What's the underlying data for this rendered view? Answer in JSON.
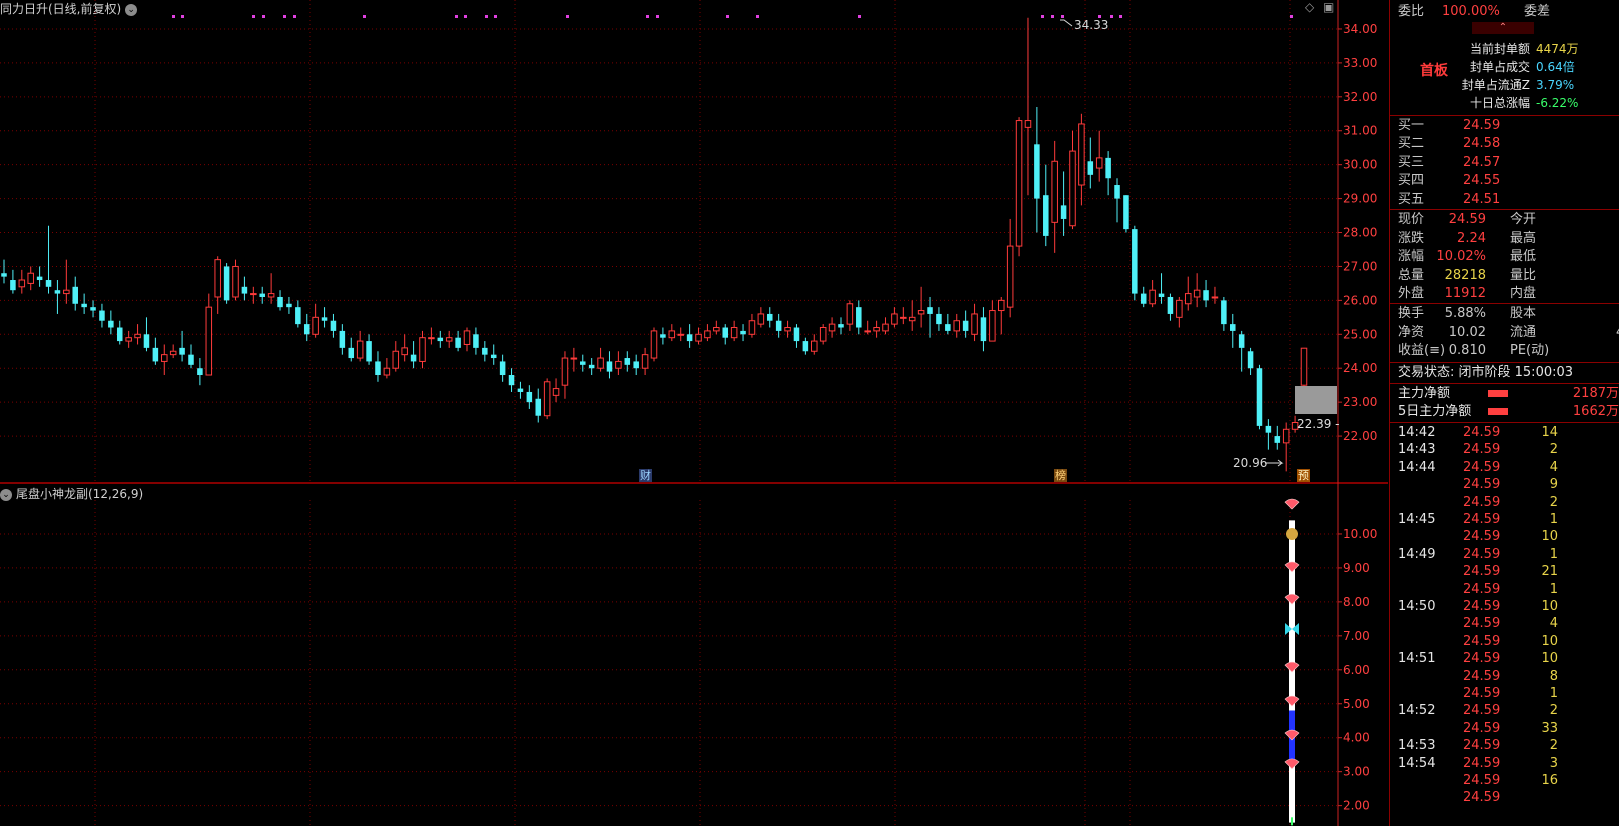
{
  "main_chart": {
    "title": "同力日升(日线,前复权)",
    "high_label": "34.33",
    "low_label": "20.96",
    "price_now_label": "22.39",
    "markers": [
      {
        "text": "财"
      },
      {
        "text": "榜"
      },
      {
        "text": "预"
      }
    ]
  },
  "sub_chart": {
    "title": "尾盘小神龙副(12,26,9)"
  },
  "chart_data": [
    {
      "type": "candlestick",
      "ylim": [
        21,
        34.5
      ],
      "y_ticks": [
        "22.00",
        "23.00",
        "24.00",
        "25.00",
        "26.00",
        "27.00",
        "28.00",
        "29.00",
        "30.00",
        "31.00",
        "32.00",
        "33.00",
        "34.00"
      ],
      "candles": [
        [
          26.8,
          26.7,
          27.2,
          26.5
        ],
        [
          26.6,
          26.3,
          26.9,
          26.2
        ],
        [
          26.4,
          26.6,
          26.9,
          26.2
        ],
        [
          26.5,
          26.8,
          27.0,
          26.3
        ],
        [
          26.7,
          26.6,
          27.0,
          26.4
        ],
        [
          26.6,
          26.4,
          28.2,
          26.2
        ],
        [
          26.3,
          26.2,
          26.6,
          25.6
        ],
        [
          26.2,
          26.3,
          27.2,
          25.9
        ],
        [
          26.4,
          25.9,
          26.7,
          25.7
        ],
        [
          25.9,
          25.8,
          26.2,
          25.6
        ],
        [
          25.8,
          25.7,
          26.0,
          25.5
        ],
        [
          25.7,
          25.4,
          25.9,
          25.2
        ],
        [
          25.4,
          25.2,
          25.7,
          25.0
        ],
        [
          25.2,
          24.8,
          25.4,
          24.7
        ],
        [
          24.8,
          24.9,
          25.1,
          24.6
        ],
        [
          24.9,
          25.0,
          25.3,
          24.7
        ],
        [
          25.0,
          24.6,
          25.5,
          24.5
        ],
        [
          24.6,
          24.2,
          24.9,
          24.1
        ],
        [
          24.2,
          24.4,
          24.7,
          23.8
        ],
        [
          24.4,
          24.5,
          24.7,
          24.3
        ],
        [
          24.6,
          24.4,
          25.1,
          24.2
        ],
        [
          24.4,
          24.1,
          24.7,
          24.0
        ],
        [
          24.0,
          23.8,
          24.3,
          23.5
        ],
        [
          23.8,
          25.8,
          26.2,
          23.8
        ],
        [
          26.1,
          27.2,
          27.3,
          25.6
        ],
        [
          27.0,
          26.0,
          27.1,
          25.9
        ],
        [
          26.1,
          27.0,
          27.2,
          26.0
        ],
        [
          26.4,
          26.2,
          26.7,
          26.0
        ],
        [
          26.2,
          26.2,
          26.4,
          25.9
        ],
        [
          26.2,
          26.1,
          26.4,
          25.9
        ],
        [
          26.1,
          26.2,
          26.8,
          25.9
        ],
        [
          26.1,
          25.8,
          26.3,
          25.7
        ],
        [
          25.9,
          25.8,
          26.1,
          25.6
        ],
        [
          25.8,
          25.3,
          26.0,
          25.2
        ],
        [
          25.3,
          25.0,
          25.6,
          24.8
        ],
        [
          25.0,
          25.5,
          25.9,
          24.9
        ],
        [
          25.5,
          25.4,
          25.8,
          25.2
        ],
        [
          25.4,
          25.1,
          25.6,
          24.9
        ],
        [
          25.1,
          24.6,
          25.3,
          24.4
        ],
        [
          24.6,
          24.3,
          24.9,
          24.2
        ],
        [
          24.3,
          24.8,
          25.1,
          24.2
        ],
        [
          24.8,
          24.2,
          25.0,
          24.1
        ],
        [
          24.2,
          23.8,
          24.5,
          23.6
        ],
        [
          23.8,
          24.0,
          24.3,
          23.7
        ],
        [
          24.0,
          24.5,
          24.8,
          23.9
        ],
        [
          24.4,
          24.6,
          25.0,
          24.2
        ],
        [
          24.4,
          24.2,
          24.8,
          24.0
        ],
        [
          24.2,
          24.9,
          25.1,
          24.0
        ],
        [
          24.9,
          24.9,
          25.2,
          24.7
        ],
        [
          24.9,
          24.8,
          25.1,
          24.6
        ],
        [
          24.8,
          24.9,
          25.1,
          24.6
        ],
        [
          24.9,
          24.6,
          25.1,
          24.5
        ],
        [
          24.7,
          25.1,
          25.2,
          24.5
        ],
        [
          25.0,
          24.6,
          25.2,
          24.4
        ],
        [
          24.6,
          24.4,
          24.8,
          24.2
        ],
        [
          24.4,
          24.3,
          24.7,
          24.1
        ],
        [
          24.2,
          23.8,
          24.4,
          23.6
        ],
        [
          23.8,
          23.5,
          24.0,
          23.3
        ],
        [
          23.4,
          23.3,
          23.6,
          23.1
        ],
        [
          23.3,
          23.0,
          23.5,
          22.8
        ],
        [
          23.1,
          22.6,
          23.4,
          22.4
        ],
        [
          22.6,
          23.6,
          23.7,
          22.5
        ],
        [
          23.2,
          23.4,
          23.7,
          23.0
        ],
        [
          23.5,
          24.3,
          24.5,
          23.1
        ],
        [
          24.3,
          24.3,
          24.6,
          23.9
        ],
        [
          24.2,
          24.1,
          24.4,
          23.9
        ],
        [
          24.1,
          24.0,
          24.3,
          23.8
        ],
        [
          24.0,
          24.3,
          24.6,
          23.9
        ],
        [
          24.2,
          23.9,
          24.5,
          23.7
        ],
        [
          24.0,
          24.2,
          24.5,
          23.8
        ],
        [
          24.3,
          24.1,
          24.5,
          23.9
        ],
        [
          24.2,
          24.0,
          24.4,
          23.8
        ],
        [
          24.0,
          24.4,
          24.6,
          23.8
        ],
        [
          24.3,
          25.1,
          25.2,
          24.2
        ],
        [
          25.0,
          24.9,
          25.2,
          24.7
        ],
        [
          24.9,
          25.1,
          25.3,
          24.8
        ],
        [
          25.0,
          25.0,
          25.2,
          24.8
        ],
        [
          25.0,
          24.8,
          25.3,
          24.6
        ],
        [
          24.8,
          25.0,
          25.2,
          24.7
        ],
        [
          24.9,
          25.1,
          25.3,
          24.8
        ],
        [
          25.1,
          25.2,
          25.4,
          25.0
        ],
        [
          25.2,
          24.9,
          25.3,
          24.7
        ],
        [
          24.9,
          25.2,
          25.4,
          24.8
        ],
        [
          25.1,
          25.0,
          25.3,
          24.8
        ],
        [
          25.0,
          25.4,
          25.6,
          24.9
        ],
        [
          25.3,
          25.6,
          25.8,
          25.2
        ],
        [
          25.6,
          25.4,
          25.8,
          25.2
        ],
        [
          25.4,
          25.1,
          25.6,
          24.9
        ],
        [
          25.1,
          25.2,
          25.4,
          24.9
        ],
        [
          25.2,
          24.8,
          25.3,
          24.6
        ],
        [
          24.8,
          24.5,
          24.9,
          24.4
        ],
        [
          24.5,
          24.8,
          25.0,
          24.4
        ],
        [
          24.8,
          25.2,
          25.3,
          24.7
        ],
        [
          25.1,
          25.3,
          25.5,
          24.9
        ],
        [
          25.3,
          25.2,
          25.5,
          25.0
        ],
        [
          25.3,
          25.9,
          26.0,
          25.1
        ],
        [
          25.8,
          25.2,
          26.0,
          25.0
        ],
        [
          25.1,
          25.1,
          25.4,
          25.0
        ],
        [
          25.1,
          25.2,
          25.4,
          24.9
        ],
        [
          25.1,
          25.3,
          25.5,
          25.0
        ],
        [
          25.3,
          25.6,
          25.8,
          25.2
        ],
        [
          25.5,
          25.5,
          25.8,
          25.3
        ],
        [
          25.4,
          25.5,
          26.0,
          25.1
        ],
        [
          25.6,
          25.7,
          26.4,
          25.2
        ],
        [
          25.8,
          25.6,
          26.1,
          24.9
        ],
        [
          25.6,
          25.3,
          25.8,
          25.1
        ],
        [
          25.3,
          25.1,
          25.6,
          25.0
        ],
        [
          25.1,
          25.4,
          25.6,
          24.9
        ],
        [
          25.4,
          25.1,
          25.7,
          24.9
        ],
        [
          25.0,
          25.6,
          25.9,
          24.8
        ],
        [
          25.5,
          24.8,
          25.8,
          24.5
        ],
        [
          24.8,
          25.7,
          26.0,
          24.8
        ],
        [
          25.7,
          26.0,
          26.1,
          25.0
        ],
        [
          25.8,
          27.6,
          28.4,
          25.5
        ],
        [
          27.6,
          31.3,
          31.4,
          27.3
        ],
        [
          31.1,
          31.3,
          34.33,
          29.1
        ],
        [
          30.6,
          29.0,
          31.7,
          28.0
        ],
        [
          29.1,
          27.9,
          30.0,
          27.6
        ],
        [
          28.3,
          30.1,
          30.7,
          27.4
        ],
        [
          28.8,
          28.4,
          29.8,
          27.9
        ],
        [
          28.2,
          30.4,
          31.0,
          28.1
        ],
        [
          29.4,
          31.2,
          31.5,
          28.8
        ],
        [
          30.1,
          29.7,
          30.8,
          29.3
        ],
        [
          29.9,
          30.2,
          31.0,
          29.5
        ],
        [
          30.2,
          29.6,
          30.4,
          29.1
        ],
        [
          29.4,
          29.0,
          29.6,
          28.3
        ],
        [
          29.1,
          28.1,
          29.1,
          28.0
        ],
        [
          28.1,
          26.2,
          28.2,
          26.0
        ],
        [
          26.2,
          25.9,
          26.4,
          25.8
        ],
        [
          25.9,
          26.3,
          26.6,
          25.8
        ],
        [
          26.2,
          26.1,
          26.8,
          25.9
        ],
        [
          26.1,
          25.6,
          26.2,
          25.4
        ],
        [
          25.5,
          26.0,
          26.1,
          25.2
        ],
        [
          25.9,
          26.2,
          26.7,
          25.7
        ],
        [
          26.1,
          26.3,
          26.8,
          25.8
        ],
        [
          26.3,
          26.0,
          26.6,
          25.8
        ],
        [
          26.1,
          26.1,
          26.4,
          25.9
        ],
        [
          26.0,
          25.3,
          26.1,
          25.1
        ],
        [
          25.3,
          25.1,
          25.6,
          24.6
        ],
        [
          25.0,
          24.6,
          25.1,
          23.9
        ],
        [
          24.5,
          24.0,
          24.6,
          23.8
        ],
        [
          24.0,
          22.3,
          24.1,
          22.2
        ],
        [
          22.3,
          22.1,
          22.5,
          21.6
        ],
        [
          22.0,
          21.8,
          22.3,
          21.6
        ],
        [
          21.8,
          22.2,
          22.4,
          20.96
        ],
        [
          22.2,
          22.4,
          22.6,
          22.1
        ],
        [
          23.5,
          24.59,
          24.6,
          23.4
        ]
      ]
    },
    {
      "type": "indicator",
      "ylim": [
        1.4,
        11.0
      ],
      "y_ticks": [
        "2.00",
        "3.00",
        "4.00",
        "5.00",
        "6.00",
        "7.00",
        "8.00",
        "9.00",
        "10.00"
      ]
    }
  ],
  "panel": {
    "weibi_label": "委比",
    "weibi_value": "100.00%",
    "weicha_label": "委差",
    "board_label": "首板",
    "seal": [
      {
        "label": "当前封单额",
        "value": "4474万",
        "color": "#e8d44a"
      },
      {
        "label": "封单占成交",
        "value": "0.64倍",
        "color": "#4ad6ff"
      },
      {
        "label": "封单占流通Z",
        "value": "3.79%",
        "color": "#4ad6ff"
      },
      {
        "label": "十日总涨幅",
        "value": "-6.22%",
        "color": "#39ff6a"
      }
    ],
    "bids": [
      {
        "label": "买一",
        "price": "24.59"
      },
      {
        "label": "买二",
        "price": "24.58"
      },
      {
        "label": "买三",
        "price": "24.57"
      },
      {
        "label": "买四",
        "price": "24.55"
      },
      {
        "label": "买五",
        "price": "24.51"
      }
    ],
    "quote": [
      {
        "l1": "现价",
        "v1": "24.59",
        "c1": "#ff4040",
        "l2": "今开"
      },
      {
        "l1": "涨跌",
        "v1": "2.24",
        "c1": "#ff4040",
        "l2": "最高"
      },
      {
        "l1": "涨幅",
        "v1": "10.02%",
        "c1": "#ff4040",
        "l2": "最低"
      },
      {
        "l1": "总量",
        "v1": "28218",
        "c1": "#e8d44a",
        "l2": "量比"
      },
      {
        "l1": "外盘",
        "v1": "11912",
        "c1": "#ff4040",
        "l2": "内盘"
      }
    ],
    "quote2": [
      {
        "l1": "换手",
        "v1": "5.88%",
        "c1": "#c8c8c8",
        "l2": "股本"
      },
      {
        "l1": "净资",
        "v1": "10.02",
        "c1": "#c8c8c8",
        "l2": "流通",
        "v2": "4"
      },
      {
        "l1": "收益(≡)",
        "v1": "0.810",
        "c1": "#c8c8c8",
        "l2": "PE(动)"
      }
    ],
    "trade_status": "交易状态: 闭市阶段 15:00:03",
    "flow": [
      {
        "label": "主力净额",
        "value": "2187万"
      },
      {
        "label": "5日主力净额",
        "value": "1662万"
      }
    ],
    "ticks": [
      {
        "time": "14:42",
        "price": "24.59",
        "vol": "14"
      },
      {
        "time": "14:43",
        "price": "24.59",
        "vol": "2"
      },
      {
        "time": "14:44",
        "price": "24.59",
        "vol": "4"
      },
      {
        "time": "",
        "price": "24.59",
        "vol": "9"
      },
      {
        "time": "",
        "price": "24.59",
        "vol": "2"
      },
      {
        "time": "14:45",
        "price": "24.59",
        "vol": "1"
      },
      {
        "time": "",
        "price": "24.59",
        "vol": "10"
      },
      {
        "time": "14:49",
        "price": "24.59",
        "vol": "1"
      },
      {
        "time": "",
        "price": "24.59",
        "vol": "21"
      },
      {
        "time": "",
        "price": "24.59",
        "vol": "1"
      },
      {
        "time": "14:50",
        "price": "24.59",
        "vol": "10"
      },
      {
        "time": "",
        "price": "24.59",
        "vol": "4"
      },
      {
        "time": "",
        "price": "24.59",
        "vol": "10"
      },
      {
        "time": "14:51",
        "price": "24.59",
        "vol": "10"
      },
      {
        "time": "",
        "price": "24.59",
        "vol": "8"
      },
      {
        "time": "",
        "price": "24.59",
        "vol": "1"
      },
      {
        "time": "14:52",
        "price": "24.59",
        "vol": "2"
      },
      {
        "time": "",
        "price": "24.59",
        "vol": "33"
      },
      {
        "time": "14:53",
        "price": "24.59",
        "vol": "2"
      },
      {
        "time": "14:54",
        "price": "24.59",
        "vol": "3"
      },
      {
        "time": "",
        "price": "24.59",
        "vol": "16"
      },
      {
        "time": "",
        "price": "24.59",
        "vol": ""
      }
    ]
  },
  "colors": {
    "up": "#ff3b3b",
    "down": "#4ff0f7",
    "grid": "#7a0000",
    "axis": "#cc2222",
    "magenta": "#e040e0"
  }
}
